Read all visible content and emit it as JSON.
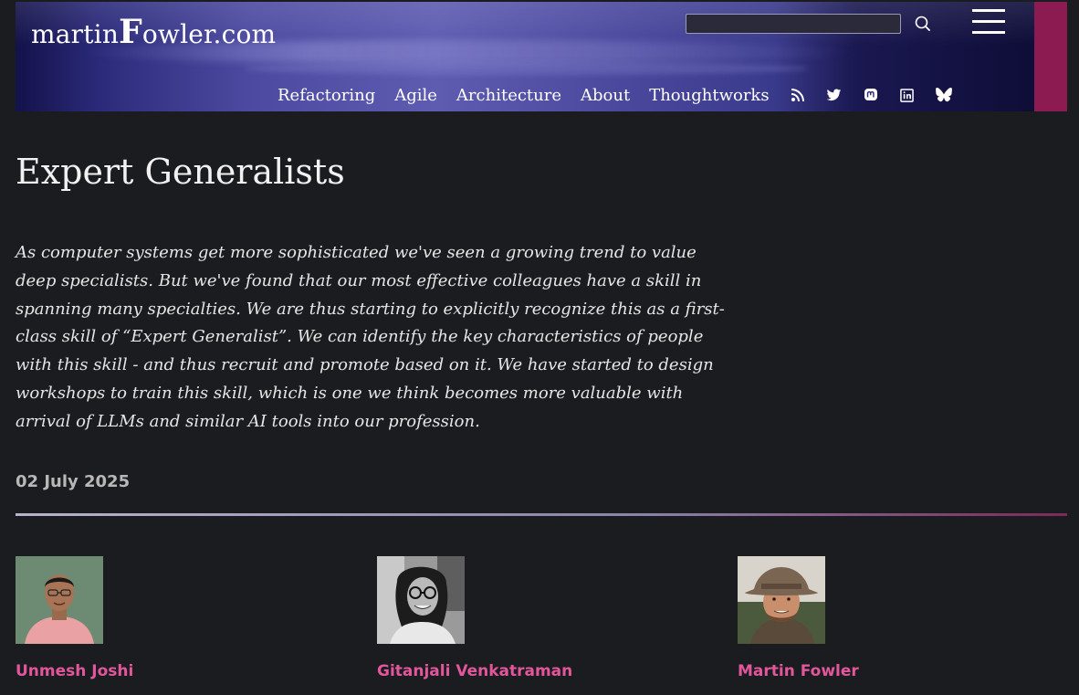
{
  "header": {
    "logo_prefix": "martin",
    "logo_big": "F",
    "logo_suffix": "owler.com",
    "search": {
      "value": "",
      "placeholder": ""
    },
    "nav": [
      {
        "label": "Refactoring"
      },
      {
        "label": "Agile"
      },
      {
        "label": "Architecture"
      },
      {
        "label": "About"
      },
      {
        "label": "Thoughtworks"
      }
    ],
    "social_icons": [
      "rss-icon",
      "twitter-icon",
      "mastodon-icon",
      "linkedin-icon",
      "bluesky-icon"
    ]
  },
  "article": {
    "title": "Expert Generalists",
    "abstract": "As computer systems get more sophisticated we've seen a growing trend to value deep specialists. But we've found that our most effective colleagues have a skill in spanning many specialties. We are thus starting to explicitly recognize this as a first-class skill of “Expert Generalist”. We can identify the key characteristics of people with this skill - and thus recruit and promote based on it. We have started to design workshops to train this skill, which is one we think becomes more valuable with arrival of LLMs and similar AI tools into our profession.",
    "date": "02 July 2025"
  },
  "authors": [
    {
      "name": "Unmesh Joshi"
    },
    {
      "name": "Gitanjali Venkatraman"
    },
    {
      "name": "Martin Fowler"
    }
  ],
  "colors": {
    "background": "#1b1c1f",
    "accent_pink": "#e2579b",
    "banner_accent": "#8c1b52",
    "text": "#e6e6e6"
  }
}
